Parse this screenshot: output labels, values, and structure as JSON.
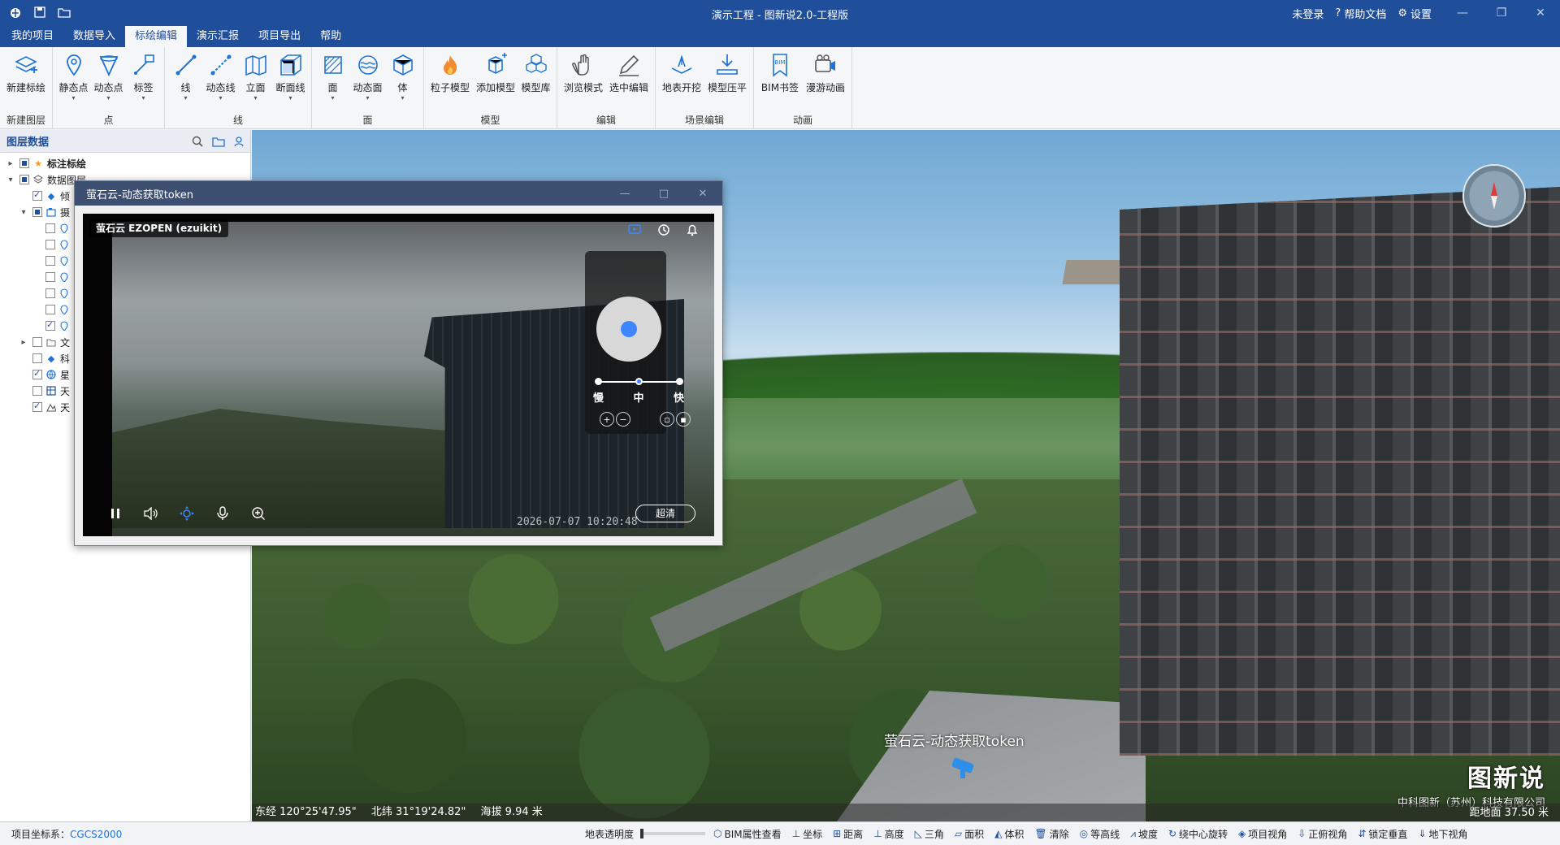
{
  "window": {
    "title": "演示工程 - 图新说2.0-工程版",
    "login": "未登录",
    "help_docs": "帮助文档",
    "settings": "设置"
  },
  "menu": [
    "我的项目",
    "数据导入",
    "标绘编辑",
    "演示汇报",
    "项目导出",
    "帮助"
  ],
  "menu_active_index": 2,
  "ribbon": {
    "groups": [
      {
        "name": "新建图层",
        "buttons": [
          {
            "label": "新建标绘",
            "icon": "layers-plus-icon"
          }
        ]
      },
      {
        "name": "点",
        "buttons": [
          {
            "label": "静态点",
            "icon": "pin-icon"
          },
          {
            "label": "动态点",
            "icon": "dynamic-point-icon"
          },
          {
            "label": "标签",
            "icon": "label-icon"
          }
        ]
      },
      {
        "name": "线",
        "buttons": [
          {
            "label": "线",
            "icon": "line-icon"
          },
          {
            "label": "动态线",
            "icon": "dynamic-line-icon"
          },
          {
            "label": "立面",
            "icon": "facade-icon"
          },
          {
            "label": "断面线",
            "icon": "section-line-icon"
          }
        ]
      },
      {
        "name": "面",
        "buttons": [
          {
            "label": "面",
            "icon": "polygon-icon"
          },
          {
            "label": "动态面",
            "icon": "dynamic-polygon-icon"
          },
          {
            "label": "体",
            "icon": "cube-icon"
          }
        ]
      },
      {
        "name": "模型",
        "buttons": [
          {
            "label": "粒子模型",
            "icon": "fire-icon"
          },
          {
            "label": "添加模型",
            "icon": "add-model-icon"
          },
          {
            "label": "模型库",
            "icon": "model-library-icon"
          }
        ]
      },
      {
        "name": "编辑",
        "buttons": [
          {
            "label": "浏览模式",
            "icon": "hand-icon"
          },
          {
            "label": "选中编辑",
            "icon": "edit-pen-icon"
          }
        ]
      },
      {
        "name": "场景编辑",
        "buttons": [
          {
            "label": "地表开挖",
            "icon": "excavate-icon"
          },
          {
            "label": "模型压平",
            "icon": "flatten-icon"
          }
        ]
      },
      {
        "name": "动画",
        "buttons": [
          {
            "label": "BIM书签",
            "icon": "bim-bookmark-icon"
          },
          {
            "label": "漫游动画",
            "icon": "camera-animation-icon"
          }
        ]
      }
    ]
  },
  "layer_panel": {
    "title": "图层数据",
    "tree": [
      {
        "level": 0,
        "expand": "▸",
        "check": "partial",
        "icon": "star-icon",
        "label": "标注标绘",
        "bold": true
      },
      {
        "level": 0,
        "expand": "▾",
        "check": "partial",
        "icon": "layers-icon",
        "label": "数据图层",
        "bold": false
      },
      {
        "level": 1,
        "expand": "",
        "check": "checked",
        "icon": "diamond-icon",
        "label": "倾",
        "bold": false
      },
      {
        "level": 1,
        "expand": "▾",
        "check": "partial",
        "icon": "camera-folder-icon",
        "label": "摄",
        "bold": false
      },
      {
        "level": 2,
        "expand": "",
        "check": "",
        "icon": "pin-icon",
        "label": "",
        "bold": false
      },
      {
        "level": 2,
        "expand": "",
        "check": "",
        "icon": "pin-icon",
        "label": "",
        "bold": false
      },
      {
        "level": 2,
        "expand": "",
        "check": "",
        "icon": "pin-icon",
        "label": "",
        "bold": false
      },
      {
        "level": 2,
        "expand": "",
        "check": "",
        "icon": "pin-icon",
        "label": "",
        "bold": false
      },
      {
        "level": 2,
        "expand": "",
        "check": "",
        "icon": "pin-icon",
        "label": "",
        "bold": false
      },
      {
        "level": 2,
        "expand": "",
        "check": "",
        "icon": "pin-icon",
        "label": "",
        "bold": false
      },
      {
        "level": 2,
        "expand": "",
        "check": "checked",
        "icon": "pin-icon",
        "label": "",
        "bold": false
      },
      {
        "level": 1,
        "expand": "▸",
        "check": "",
        "icon": "folder-icon",
        "label": "文",
        "bold": false
      },
      {
        "level": 1,
        "expand": "",
        "check": "",
        "icon": "diamond-icon",
        "label": "科",
        "bold": false
      },
      {
        "level": 1,
        "expand": "",
        "check": "checked",
        "icon": "globe-icon",
        "label": "星",
        "bold": false
      },
      {
        "level": 1,
        "expand": "",
        "check": "",
        "icon": "map-layer-icon",
        "label": "天",
        "bold": false
      },
      {
        "level": 1,
        "expand": "",
        "check": "checked",
        "icon": "terrain-icon",
        "label": "天",
        "bold": false
      }
    ]
  },
  "video_dialog": {
    "title": "萤石云-动态获取token",
    "player_tag": "萤石云 EZOPEN (ezuikit)",
    "speed_labels": [
      "慢",
      "中",
      "快"
    ],
    "timestamp": "2026-07-07 10:20:48",
    "quality": "超清"
  },
  "viewport": {
    "east": "东经 120°25'47.95\"",
    "north": "北纬 31°19'24.82\"",
    "altitude": "海拔 9.94 米",
    "camera_label": "萤石云-动态获取token",
    "brand_name": "图新说",
    "brand_company": "中科图新（苏州）科技有限公司",
    "distance": "距地面 37.50 米"
  },
  "statusbar": {
    "crs_label": "项目坐标系：",
    "crs_value": "CGCS2000",
    "transparency": "地表透明度",
    "tools": [
      {
        "label": "BIM属性查看",
        "icon": "bim-property-icon"
      },
      {
        "label": "坐标",
        "icon": "coordinate-icon"
      },
      {
        "label": "距离",
        "icon": "distance-icon"
      },
      {
        "label": "高度",
        "icon": "height-icon"
      },
      {
        "label": "三角",
        "icon": "triangle-icon"
      },
      {
        "label": "面积",
        "icon": "area-icon"
      },
      {
        "label": "体积",
        "icon": "volume-icon"
      },
      {
        "label": "清除",
        "icon": "trash-icon"
      },
      {
        "label": "等高线",
        "icon": "contour-icon"
      },
      {
        "label": "坡度",
        "icon": "slope-icon"
      },
      {
        "label": "绕中心旋转",
        "icon": "rotate-icon"
      },
      {
        "label": "项目视角",
        "icon": "project-view-icon"
      },
      {
        "label": "正俯视角",
        "icon": "top-view-icon"
      },
      {
        "label": "锁定垂直",
        "icon": "lock-vertical-icon"
      },
      {
        "label": "地下视角",
        "icon": "underground-icon"
      }
    ]
  }
}
